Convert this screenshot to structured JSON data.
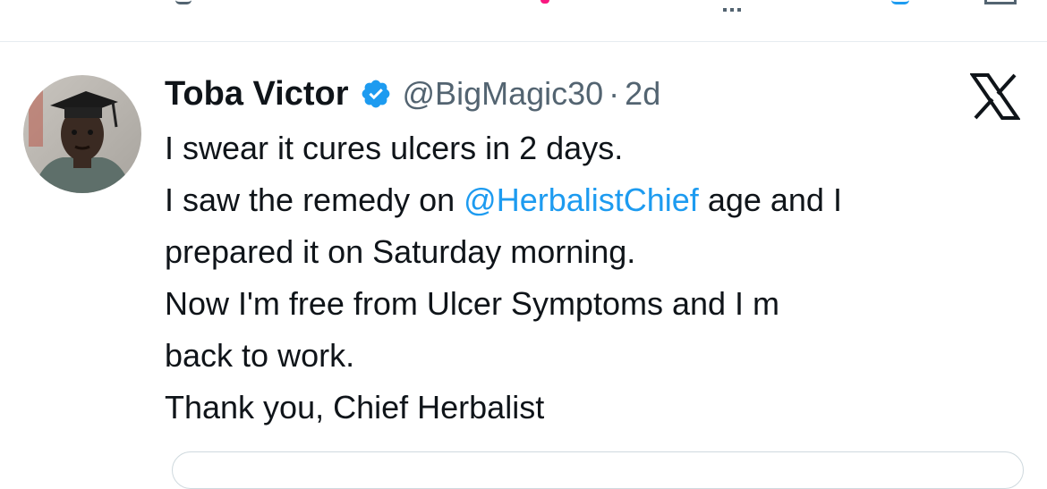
{
  "tweet": {
    "author_name": "Toba Victor",
    "handle": "@BigMagic30",
    "separator": "·",
    "age": "2d",
    "verified": true,
    "lines": [
      {
        "text": "I swear it cures ulcers in 2 days."
      },
      {
        "before": "I saw the remedy on ",
        "mention": "@HerbalistChief",
        "after": " age and I"
      },
      {
        "text": "prepared it on Saturday morning."
      },
      {
        "text": "Now I'm free from Ulcer Symptoms and I m"
      },
      {
        "text": "back to work."
      },
      {
        "text": "Thank you, Chief Herbalist"
      }
    ]
  },
  "icons": {
    "verified": "verified-badge-icon",
    "platform": "x-logo-icon"
  },
  "colors": {
    "accent": "#1d9bf0",
    "text": "#0f1419",
    "secondary": "#536471",
    "like": "#f91880",
    "divider": "#e6ecf0"
  }
}
